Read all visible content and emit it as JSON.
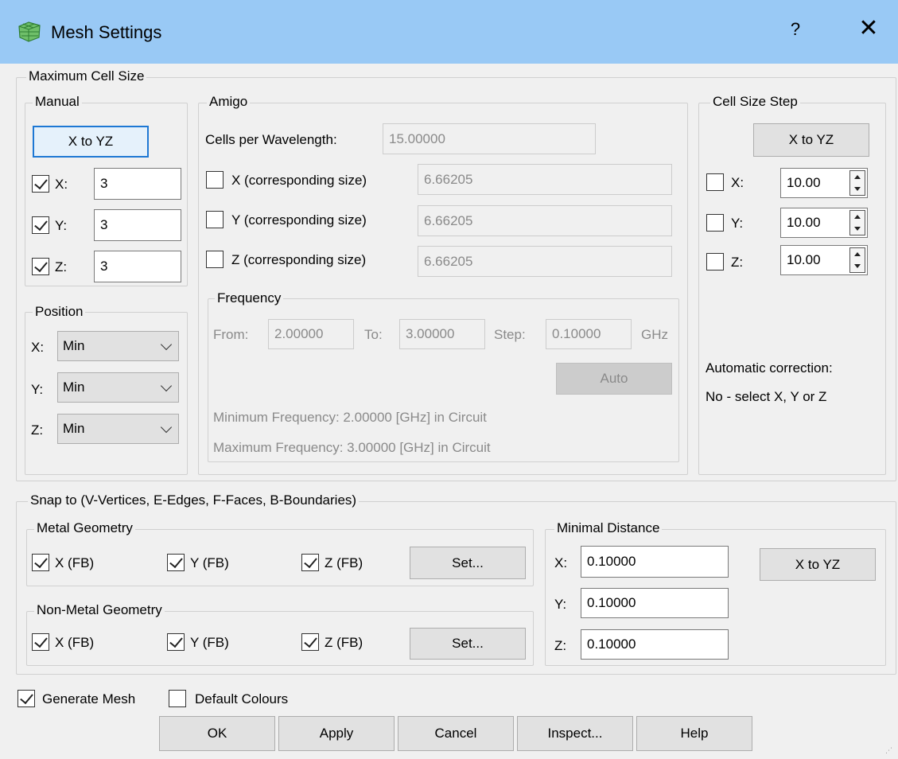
{
  "window": {
    "title": "Mesh Settings",
    "help": "?",
    "close": "✕"
  },
  "max_cell": {
    "legend": "Maximum Cell Size",
    "manual": {
      "legend": "Manual",
      "xtoyz": "X to YZ",
      "rows": [
        {
          "label": "X:",
          "value": "3",
          "checked": true
        },
        {
          "label": "Y:",
          "value": "3",
          "checked": true
        },
        {
          "label": "Z:",
          "value": "3",
          "checked": true
        }
      ]
    },
    "position": {
      "legend": "Position",
      "rows": [
        {
          "label": "X:",
          "value": "Min"
        },
        {
          "label": "Y:",
          "value": "Min"
        },
        {
          "label": "Z:",
          "value": "Min"
        }
      ]
    },
    "amigo": {
      "legend": "Amigo",
      "cells_label": "Cells per Wavelength:",
      "cells_value": "15.00000",
      "rows": [
        {
          "label": "X (corresponding size)",
          "value": "6.66205",
          "checked": false
        },
        {
          "label": "Y (corresponding size)",
          "value": "6.66205",
          "checked": false
        },
        {
          "label": "Z (corresponding size)",
          "value": "6.66205",
          "checked": false
        }
      ],
      "frequency": {
        "legend": "Frequency",
        "from_label": "From:",
        "from_value": "2.00000",
        "to_label": "To:",
        "to_value": "3.00000",
        "step_label": "Step:",
        "step_value": "0.10000",
        "unit": "GHz",
        "auto": "Auto",
        "min_text": "Minimum Frequency: 2.00000 [GHz] in Circuit",
        "max_text": "Maximum Frequency: 3.00000 [GHz] in Circuit"
      }
    },
    "cell_step": {
      "legend": "Cell Size Step",
      "xtoyz": "X to YZ",
      "rows": [
        {
          "label": "X:",
          "value": "10.00",
          "checked": false
        },
        {
          "label": "Y:",
          "value": "10.00",
          "checked": false
        },
        {
          "label": "Z:",
          "value": "10.00",
          "checked": false
        }
      ],
      "auto_label": "Automatic correction:",
      "auto_value": "No - select X, Y or Z"
    }
  },
  "snap": {
    "legend": "Snap to (V-Vertices, E-Edges, F-Faces, B-Boundaries)",
    "metal": {
      "legend": "Metal Geometry",
      "items": [
        {
          "label": "X (FB)",
          "checked": true
        },
        {
          "label": "Y (FB)",
          "checked": true
        },
        {
          "label": "Z (FB)",
          "checked": true
        }
      ],
      "set": "Set..."
    },
    "nonmetal": {
      "legend": "Non-Metal Geometry",
      "items": [
        {
          "label": "X (FB)",
          "checked": true
        },
        {
          "label": "Y (FB)",
          "checked": true
        },
        {
          "label": "Z (FB)",
          "checked": true
        }
      ],
      "set": "Set..."
    },
    "mindist": {
      "legend": "Minimal Distance",
      "rows": [
        {
          "label": "X:",
          "value": "0.10000"
        },
        {
          "label": "Y:",
          "value": "0.10000"
        },
        {
          "label": "Z:",
          "value": "0.10000"
        }
      ],
      "xtoyz": "X to YZ"
    }
  },
  "options": {
    "generate_mesh": {
      "label": "Generate Mesh",
      "checked": true
    },
    "default_colours": {
      "label": "Default Colours",
      "checked": false
    }
  },
  "buttons": {
    "ok": "OK",
    "apply": "Apply",
    "cancel": "Cancel",
    "inspect": "Inspect...",
    "help": "Help"
  }
}
